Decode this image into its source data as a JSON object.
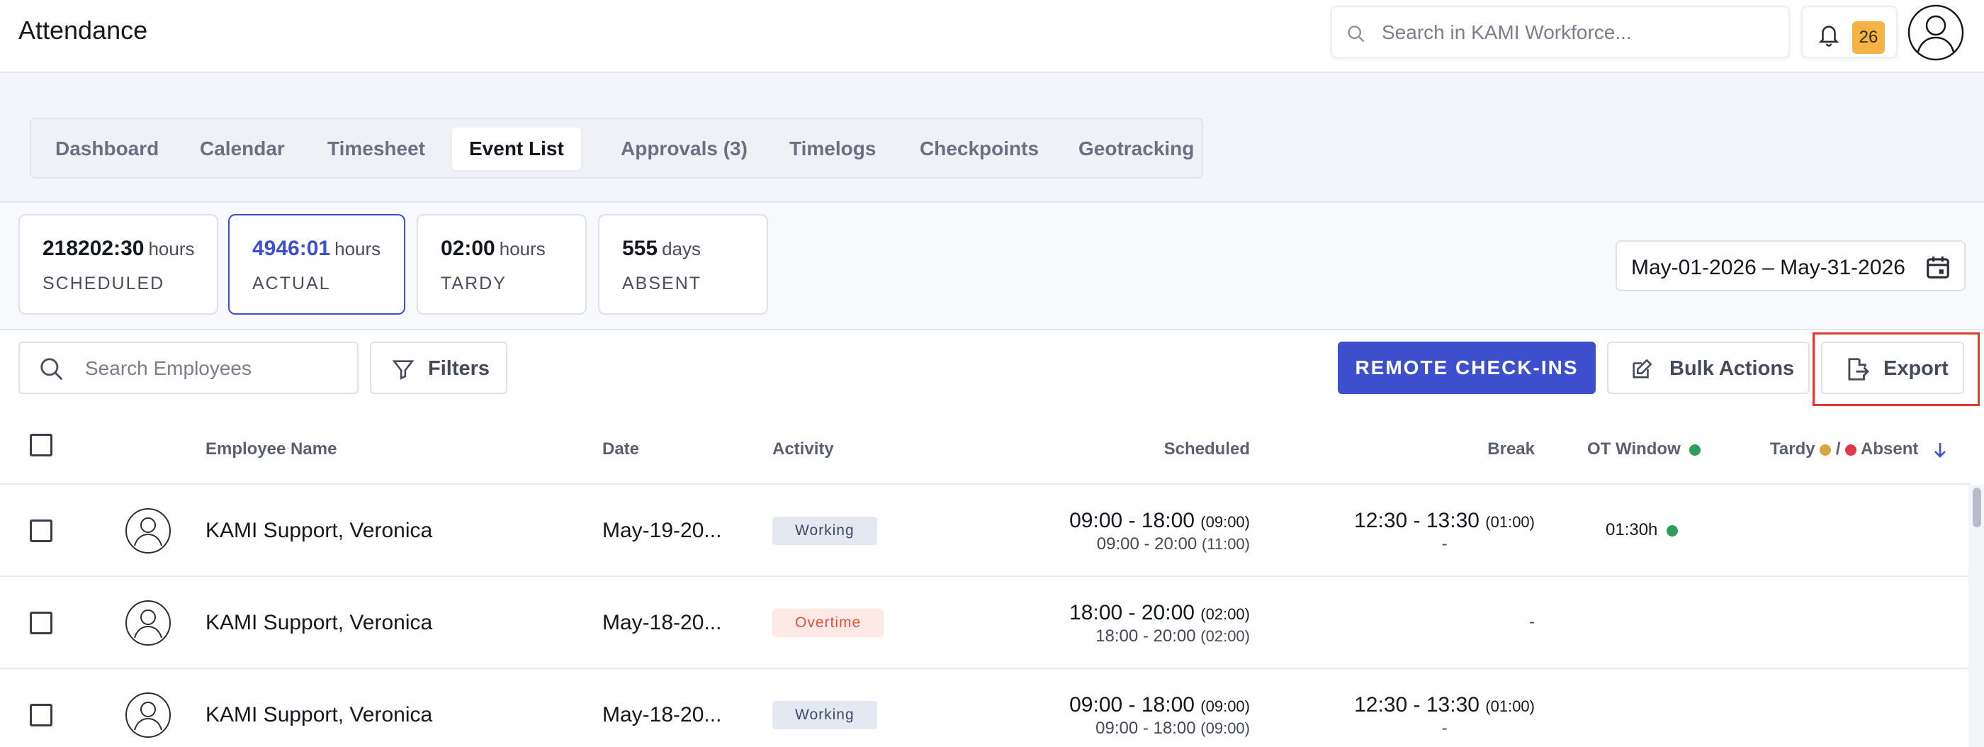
{
  "header": {
    "title": "Attendance",
    "search_placeholder": "Search in KAMI Workforce...",
    "notification_count": "26"
  },
  "tabs": [
    {
      "label": "Dashboard",
      "active": false
    },
    {
      "label": "Calendar",
      "active": false
    },
    {
      "label": "Timesheet",
      "active": false
    },
    {
      "label": "Event List",
      "active": true
    },
    {
      "label": "Approvals (3)",
      "active": false
    },
    {
      "label": "Timelogs",
      "active": false
    },
    {
      "label": "Checkpoints",
      "active": false
    },
    {
      "label": "Geotracking",
      "active": false
    }
  ],
  "summary": [
    {
      "value": "218202:30",
      "unit": "hours",
      "label": "SCHEDULED"
    },
    {
      "value": "4946:01",
      "unit": "hours",
      "label": "ACTUAL"
    },
    {
      "value": "02:00",
      "unit": "hours",
      "label": "TARDY"
    },
    {
      "value": "555",
      "unit": "days",
      "label": "ABSENT"
    }
  ],
  "date_range": "May-01-2026 – May-31-2026",
  "toolbar": {
    "employee_search_placeholder": "Search Employees",
    "filters_label": "Filters",
    "remote_checkins_label": "REMOTE CHECK-INS",
    "bulk_actions_label": "Bulk Actions",
    "export_label": "Export"
  },
  "table": {
    "columns": {
      "employee_name": "Employee Name",
      "date": "Date",
      "activity": "Activity",
      "scheduled": "Scheduled",
      "break": "Break",
      "ot_window": "OT Window",
      "tardy": "Tardy",
      "separator": "/",
      "absent": "Absent"
    },
    "rows": [
      {
        "name": "KAMI Support, Veronica",
        "date": "May-19-20...",
        "activity": "Working",
        "activity_type": "working",
        "scheduled_main": "09:00 - 18:00",
        "scheduled_main_dur": "(09:00)",
        "scheduled_sub": "09:00 - 20:00",
        "scheduled_sub_dur": "(11:00)",
        "break_main": "12:30 - 13:30",
        "break_main_dur": "(01:00)",
        "break_sub": "-",
        "ot": "01:30h"
      },
      {
        "name": "KAMI Support, Veronica",
        "date": "May-18-20...",
        "activity": "Overtime",
        "activity_type": "overtime",
        "scheduled_main": "18:00 - 20:00",
        "scheduled_main_dur": "(02:00)",
        "scheduled_sub": "18:00 - 20:00",
        "scheduled_sub_dur": "(02:00)",
        "break_main": "",
        "break_main_dur": "",
        "break_sub": "-",
        "ot": ""
      },
      {
        "name": "KAMI Support, Veronica",
        "date": "May-18-20...",
        "activity": "Working",
        "activity_type": "working",
        "scheduled_main": "09:00 - 18:00",
        "scheduled_main_dur": "(09:00)",
        "scheduled_sub": "09:00 - 18:00",
        "scheduled_sub_dur": "(09:00)",
        "break_main": "12:30 - 13:30",
        "break_main_dur": "(01:00)",
        "break_sub": "-",
        "ot": ""
      }
    ]
  },
  "colors": {
    "accent": "#3d4fcc",
    "badge": "#f4b344",
    "ot_dot": "#2e9e5b",
    "tardy_dot": "#d6a73a",
    "absent_dot": "#e0384a",
    "highlight": "#e03a2e"
  }
}
